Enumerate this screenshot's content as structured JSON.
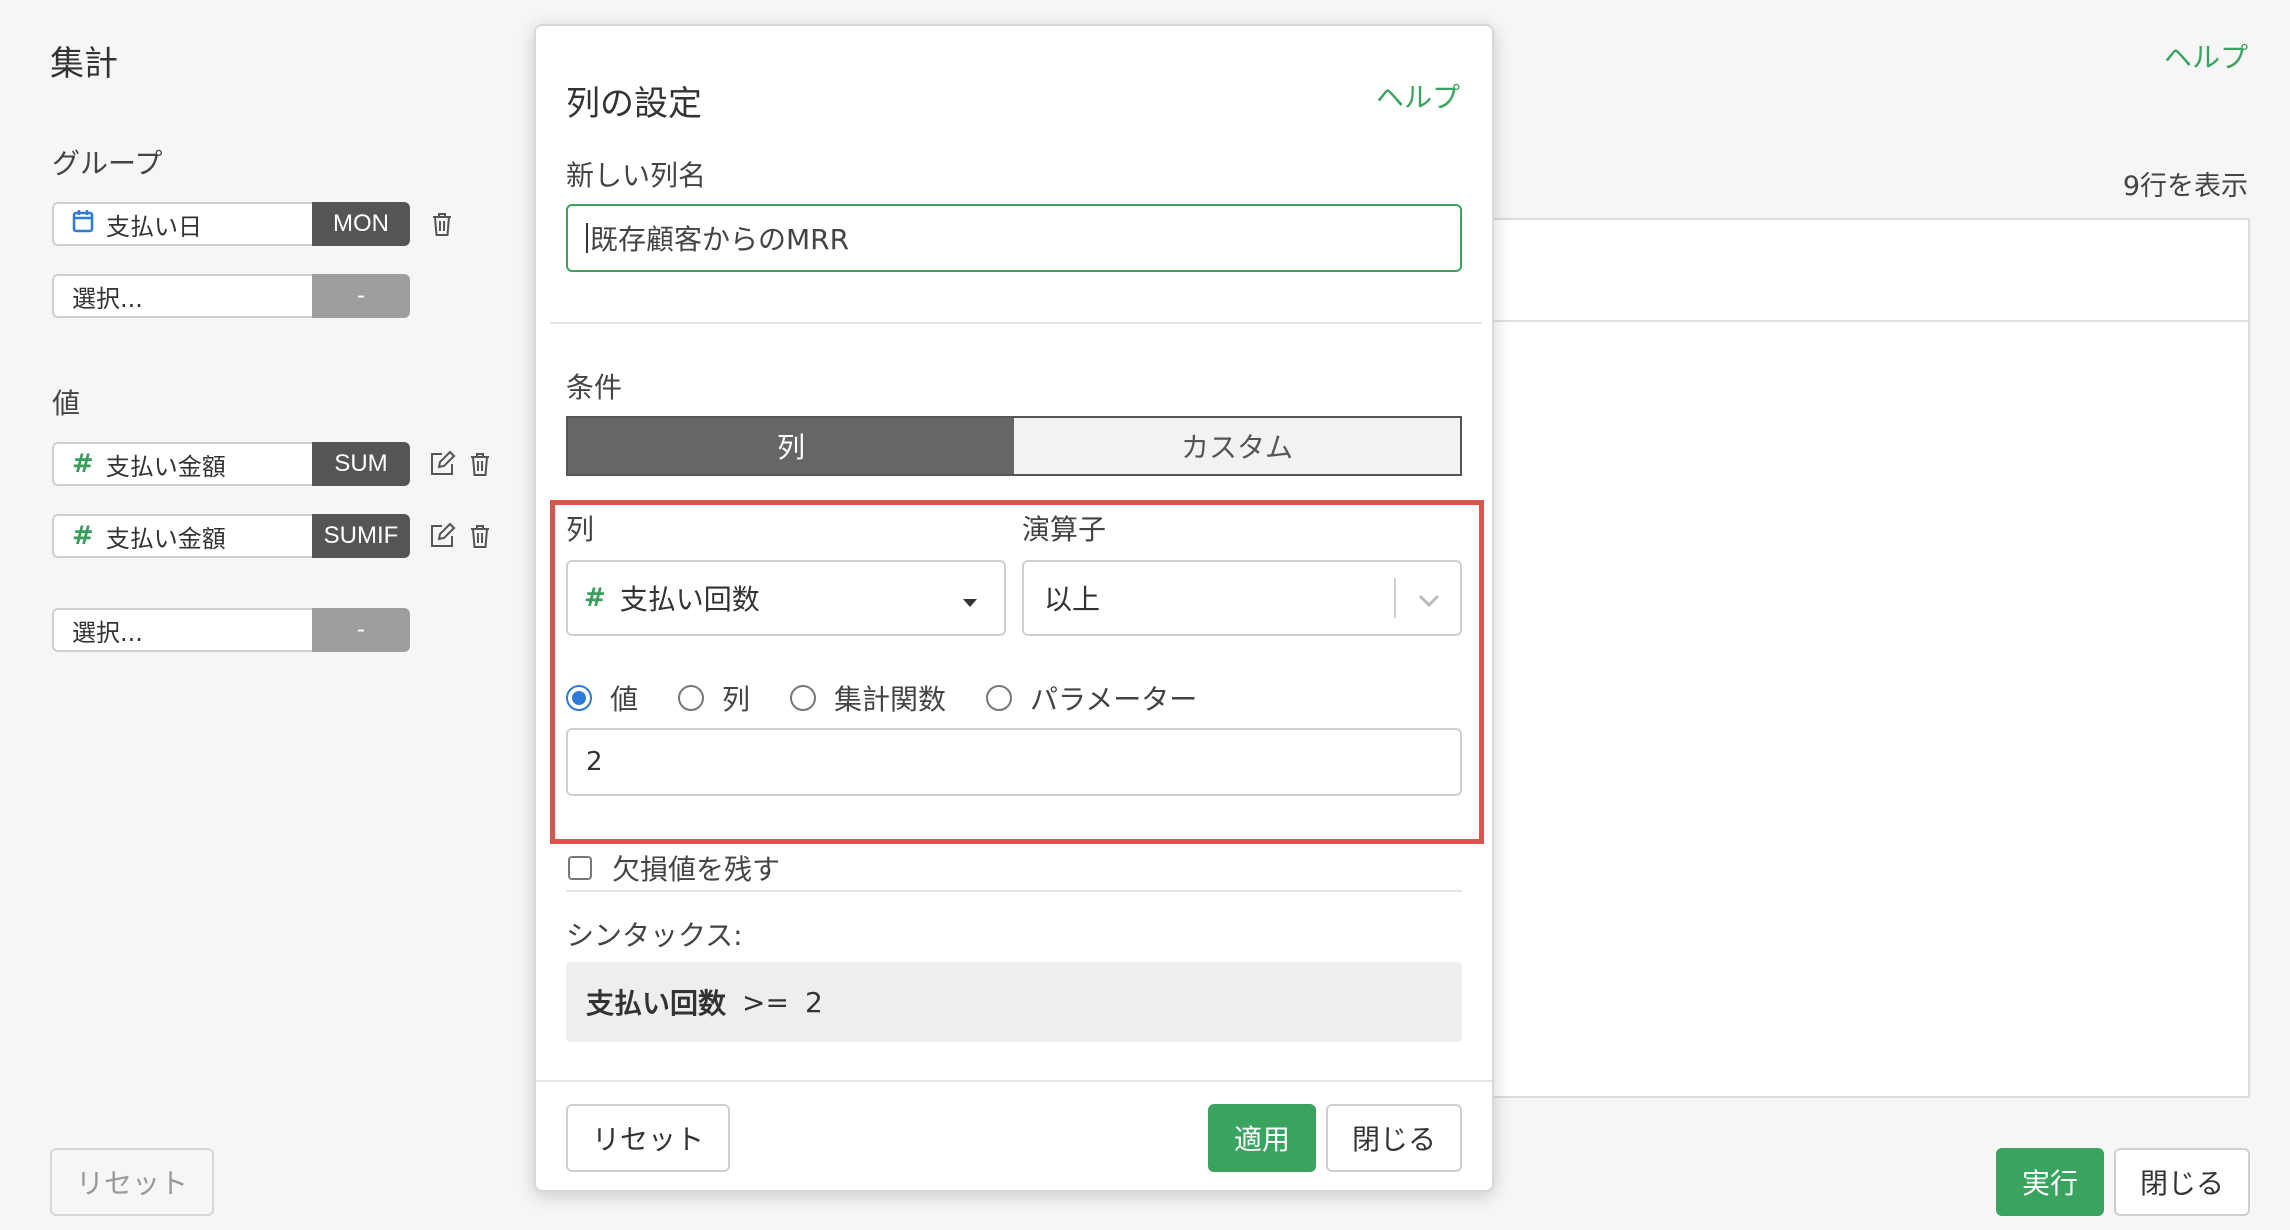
{
  "left_panel": {
    "title": "集計",
    "group_label": "グループ",
    "group_items": [
      {
        "field": "支払い日",
        "tag": "MON",
        "icon": "calendar-icon"
      },
      {
        "field": "選択...",
        "tag": "-"
      }
    ],
    "value_label": "値",
    "value_items": [
      {
        "field": "支払い金額",
        "tag": "SUM",
        "icon": "hash-icon"
      },
      {
        "field": "支払い金額",
        "tag": "SUMIF",
        "icon": "hash-icon"
      },
      {
        "field": "選択...",
        "tag": "-"
      }
    ],
    "hash_glyph": "#",
    "reset_label": "リセット"
  },
  "right_panel": {
    "help_label": "ヘルプ",
    "rows_count": "9行を表示",
    "run_label": "実行",
    "close_label": "閉じる"
  },
  "dialog": {
    "title": "列の設定",
    "help_label": "ヘルプ",
    "name_label": "新しい列名",
    "name_value": "既存顧客からのMRR",
    "condition_label": "条件",
    "tabs": [
      {
        "label": "列",
        "active": true
      },
      {
        "label": "カスタム",
        "active": false
      }
    ],
    "column_label": "列",
    "column_value": "支払い回数",
    "operator_label": "演算子",
    "operator_value": "以上",
    "radio_options": [
      {
        "label": "値",
        "selected": true
      },
      {
        "label": "列",
        "selected": false
      },
      {
        "label": "集計関数",
        "selected": false
      },
      {
        "label": "パラメーター",
        "selected": false
      }
    ],
    "value_input": "2",
    "keep_missing_label": "欠損値を残す",
    "syntax_label": "シンタックス:",
    "syntax": {
      "column": "支払い回数",
      "operator": ">=",
      "value": "2"
    },
    "reset_label": "リセット",
    "apply_label": "適用",
    "close_label": "閉じる"
  },
  "colors": {
    "accent_green": "#3aa35f",
    "highlight_red": "#d9534f",
    "radio_blue": "#2f7ad6",
    "tag_dark": "#555555"
  }
}
